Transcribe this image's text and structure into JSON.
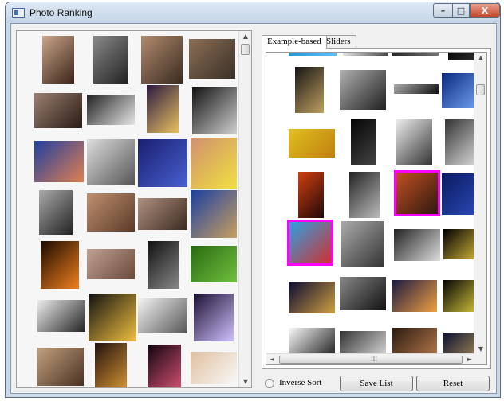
{
  "window": {
    "title": "Photo Ranking"
  },
  "tabs": [
    {
      "label": "Example-based"
    },
    {
      "label": "Sliders"
    }
  ],
  "controls": {
    "inverse_sort_label": "Inverse Sort",
    "inverse_sort_checked": false,
    "save_label": "Save List",
    "reset_label": "Reset"
  },
  "icons": {
    "scroll_up": "▲",
    "scroll_down": "▼",
    "scroll_left": "◄",
    "scroll_right": "►",
    "grip": "III",
    "minimize": "–",
    "maximize": "□",
    "close": "X"
  },
  "colors": {
    "selection": "#ff00ff"
  },
  "left_photos": [
    {
      "name": "woman-face-photo"
    },
    {
      "name": "woman-headscarf-photo"
    },
    {
      "name": "man-glasses-photo"
    },
    {
      "name": "old-man-beard-photo"
    },
    {
      "name": "screaming-man-photo"
    },
    {
      "name": "mushroom-photo"
    },
    {
      "name": "ferris-wheel-photo"
    },
    {
      "name": "white-flower-photo"
    },
    {
      "name": "baby-cards-photo"
    },
    {
      "name": "astronaut-photo"
    },
    {
      "name": "blue-night-city-photo"
    },
    {
      "name": "woman-flowers-photo"
    },
    {
      "name": "monument-silhouette-photo"
    },
    {
      "name": "smiling-woman-photo"
    },
    {
      "name": "two-old-men-photo"
    },
    {
      "name": "silhouette-blue-sky-photo"
    },
    {
      "name": "orange-flower-photo"
    },
    {
      "name": "old-woman-photo"
    },
    {
      "name": "dark-plant-photo"
    },
    {
      "name": "green-leaf-photo"
    },
    {
      "name": "bw-smoke-photo"
    },
    {
      "name": "glowing-flower-photo"
    },
    {
      "name": "power-lines-photo"
    },
    {
      "name": "purple-flower-photo"
    },
    {
      "name": "woman-hat-photo"
    },
    {
      "name": "bottles-night-photo"
    },
    {
      "name": "fireworks-photo"
    },
    {
      "name": "baby-white-hat-photo"
    }
  ],
  "right_photos": [
    {
      "name": "blue-strip-photo"
    },
    {
      "name": "white-strip-photo"
    },
    {
      "name": "dark-strip-photo"
    },
    {
      "name": "black-strip-photo"
    },
    {
      "name": "dark-statue-photo"
    },
    {
      "name": "white-building-photo"
    },
    {
      "name": "bw-strip-photo"
    },
    {
      "name": "blue-lake-photo"
    },
    {
      "name": "yellow-lizard-photo"
    },
    {
      "name": "dark-figure-photo"
    },
    {
      "name": "street-person-photo"
    },
    {
      "name": "palm-tree-bw-photo"
    },
    {
      "name": "orange-sunset-photo"
    },
    {
      "name": "doorway-man-photo"
    },
    {
      "name": "man-shooting-photo",
      "selected": true
    },
    {
      "name": "moon-night-photo"
    },
    {
      "name": "man-bagpipe-photo",
      "selected": true
    },
    {
      "name": "woman-laptop-photo"
    },
    {
      "name": "hands-bw-photo"
    },
    {
      "name": "light-spiral-photo"
    },
    {
      "name": "opera-house-photo"
    },
    {
      "name": "bw-men-photo"
    },
    {
      "name": "city-night-photo"
    },
    {
      "name": "yellow-flower-photo"
    },
    {
      "name": "black-silhouette-photo"
    },
    {
      "name": "bw-road-photo"
    },
    {
      "name": "dark-arch-photo"
    },
    {
      "name": "pier-night-photo"
    }
  ]
}
